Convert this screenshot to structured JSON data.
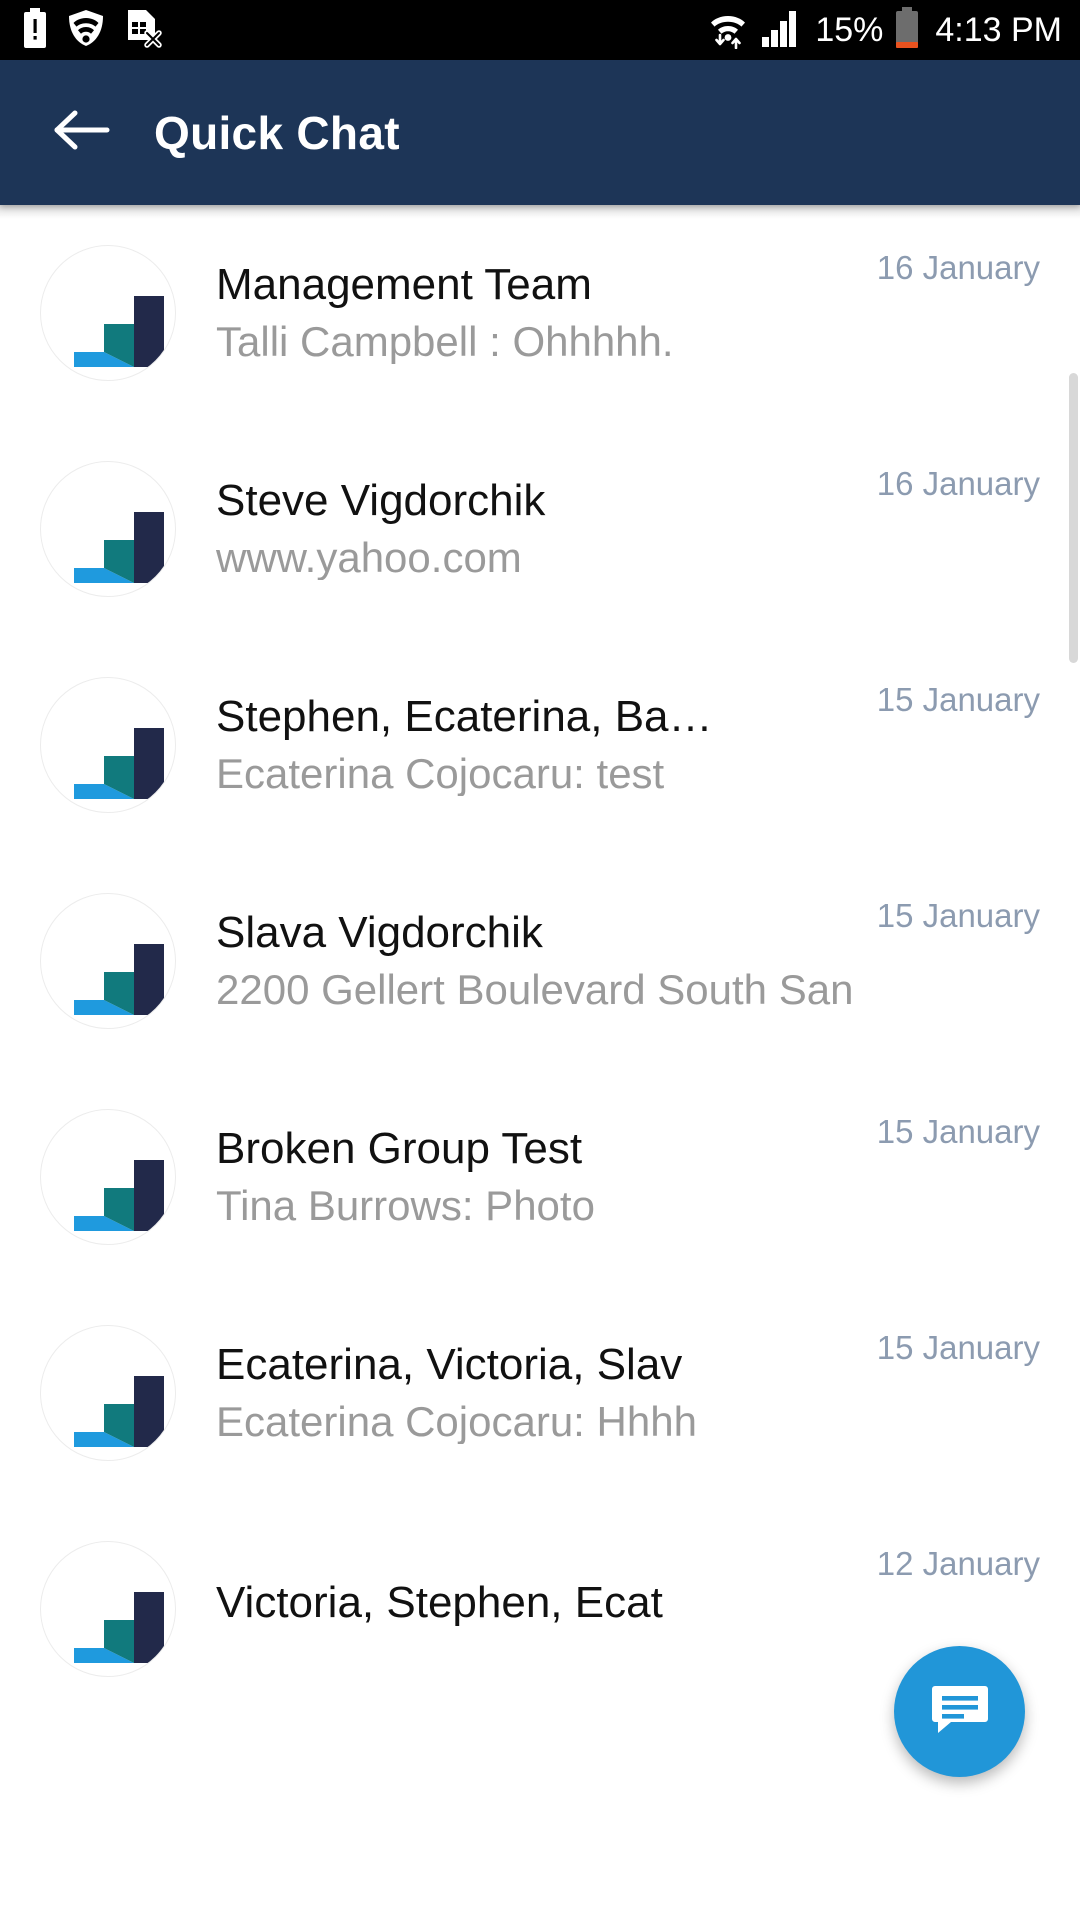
{
  "statusbar": {
    "battery_percent": "15%",
    "time": "4:13 PM",
    "icons": {
      "battery_alert": "battery-alert-icon",
      "vpn_shield": "vpn-shield-icon",
      "sim_error": "sim-card-error-icon",
      "wifi_transfer": "wifi-data-transfer-icon",
      "cellular_signal": "cellular-signal-icon",
      "battery_level": "battery-icon"
    },
    "colors": {
      "background": "#000000",
      "foreground": "#ffffff",
      "battery_low": "#e8521f"
    }
  },
  "appbar": {
    "title": "Quick Chat",
    "back_icon": "arrow-back-icon",
    "background": "#1d3557",
    "text_color": "#ffffff"
  },
  "fab": {
    "icon": "chat-bubble-icon",
    "color": "#2196d8"
  },
  "theme": {
    "avatar_bar_light_blue": "#1f9ade",
    "avatar_bar_teal": "#117a7d",
    "avatar_bar_navy": "#22294a",
    "date_color": "#8c9bb0",
    "subtitle_color": "#9a9a9a",
    "title_color": "#111111"
  },
  "conversations": [
    {
      "title": "Management Team",
      "preview": "Talli Campbell : Ohhhhh.",
      "date": "16 January",
      "avatar": "bar-chart-logo"
    },
    {
      "title": "Steve Vigdorchik",
      "preview": "www.yahoo.com",
      "date": "16 January",
      "avatar": "bar-chart-logo"
    },
    {
      "title": "Stephen, Ecaterina, Ba…",
      "preview": "Ecaterina Cojocaru: test",
      "date": "15 January",
      "avatar": "bar-chart-logo"
    },
    {
      "title": "Slava  Vigdorchik",
      "preview": "2200 Gellert Boulevard South San",
      "date": "15 January",
      "avatar": "bar-chart-logo"
    },
    {
      "title": "Broken Group Test",
      "preview": "Tina Burrows: Photo",
      "date": "15 January",
      "avatar": "bar-chart-logo"
    },
    {
      "title": "Ecaterina, Victoria, Slav",
      "preview": "Ecaterina Cojocaru: Hhhh",
      "date": "15 January",
      "avatar": "bar-chart-logo"
    },
    {
      "title": "Victoria, Stephen, Ecat",
      "preview": "",
      "date": "12 January",
      "avatar": "bar-chart-logo"
    }
  ]
}
